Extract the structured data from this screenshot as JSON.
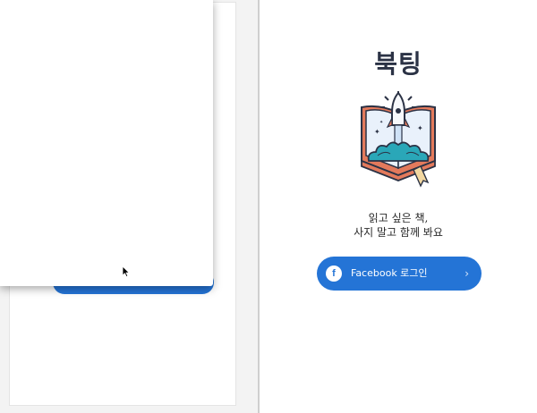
{
  "app": {
    "title": "북팅",
    "tagline_line1": "읽고 싶은 책,",
    "tagline_line2": "사지 말고 함께 봐요"
  },
  "login": {
    "button_label": "Facebook 로그인",
    "icon_glyph": "f",
    "chevron_glyph": "›"
  },
  "icons": {
    "logo": "rocket-book-icon",
    "facebook": "facebook-icon",
    "cursor": "mouse-cursor-icon"
  },
  "colors": {
    "brand_blue": "#2474d6",
    "title_navy": "#2b3245"
  }
}
